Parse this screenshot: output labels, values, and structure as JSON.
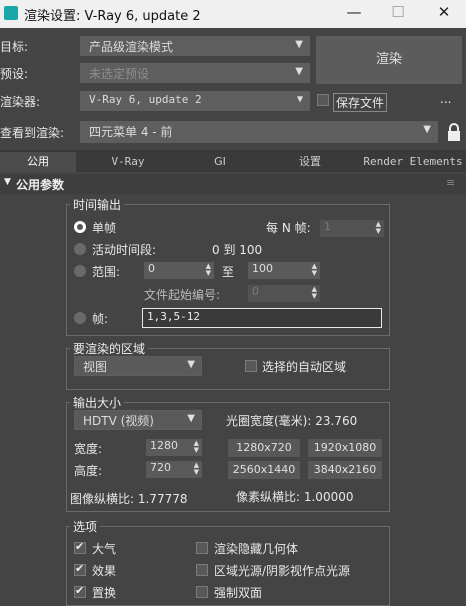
{
  "window": {
    "title": "渲染设置: V-Ray 6, update 2",
    "minimize": "—",
    "maximize": "☐",
    "close": "✕"
  },
  "top": {
    "target_label": "目标:",
    "target_value": "产品级渲染模式",
    "preset_label": "预设:",
    "preset_value": "未选定预设",
    "renderer_label": "渲染器:",
    "renderer_value": "V-Ray 6, update 2",
    "save_file_label": "保存文件",
    "more": "...",
    "render_button": "渲染",
    "view_label": "查看到渲染:",
    "view_value": "四元菜单 4 - 前"
  },
  "tabs": [
    "公用",
    "V-Ray",
    "GI",
    "设置",
    "Render Elements"
  ],
  "rollout": {
    "title": "公用参数",
    "marker": "≡"
  },
  "time_output": {
    "title": "时间输出",
    "single": "单帧",
    "every_n_label": "每 N 帧:",
    "every_n_value": "1",
    "active_segment": "活动时间段:",
    "active_range": "0 到 100",
    "range_label": "范围:",
    "range_from": "0",
    "range_to_label": "至",
    "range_to": "100",
    "file_start_label": "文件起始编号:",
    "file_start_value": "0",
    "frames_label": "帧:",
    "frames_value": "1,3,5-12"
  },
  "area": {
    "title": "要渲染的区域",
    "value": "视图",
    "auto_region": "选择的自动区域"
  },
  "output_size": {
    "title": "输出大小",
    "preset": "HDTV (视频)",
    "aperture": "光圈宽度(毫米): 23.760",
    "width_label": "宽度:",
    "width": "1280",
    "height_label": "高度:",
    "height": "720",
    "presets": [
      "1280x720",
      "1920x1080",
      "2560x1440",
      "3840x2160"
    ],
    "image_aspect": "图像纵横比: 1.77778",
    "pixel_aspect": "像素纵横比: 1.00000"
  },
  "options": {
    "title": "选项",
    "items": [
      {
        "label": "大气",
        "checked": true
      },
      {
        "label": "渲染隐藏几何体",
        "checked": false
      },
      {
        "label": "效果",
        "checked": true
      },
      {
        "label": "区域光源/阴影视作点光源",
        "checked": false
      },
      {
        "label": "置换",
        "checked": true
      },
      {
        "label": "强制双面",
        "checked": false
      }
    ]
  }
}
